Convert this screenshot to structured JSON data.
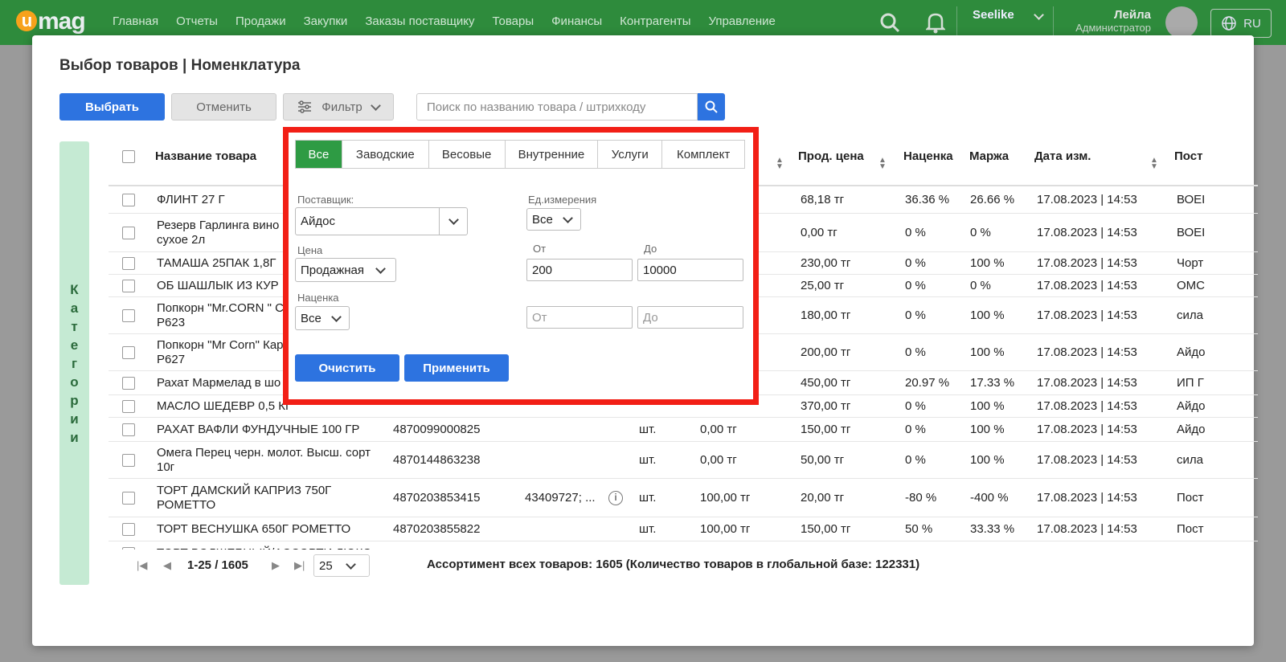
{
  "topbar": {
    "logo": "mag",
    "logo_u": "u",
    "nav": [
      "Главная",
      "Отчеты",
      "Продажи",
      "Закупки",
      "Заказы поставщику",
      "Товары",
      "Финансы",
      "Контрагенты",
      "Управление"
    ],
    "store": "Seelike",
    "user_name": "Лейла",
    "user_role": "Администратор",
    "lang": "RU",
    "icons": [
      "search-icon",
      "bell-icon",
      "avatar",
      "globe-icon"
    ],
    "accent": "#2e8b3c"
  },
  "modal": {
    "title": "Выбор товаров | Номенклатура",
    "select_btn": "Выбрать",
    "cancel_btn": "Отменить",
    "filter_btn": "Фильтр",
    "search_placeholder": "Поиск по названию товара / штрихкоду",
    "categories_label": [
      "К",
      "а",
      "т",
      "е",
      "г",
      "о",
      "р",
      "и",
      "и"
    ]
  },
  "table": {
    "headers": {
      "name": "Название товара",
      "prod_price": "Прод. цена",
      "markup": "Наценка",
      "margin": "Маржа",
      "date": "Дата изм.",
      "supplier": "Пост"
    },
    "rows": [
      {
        "name": "ФЛИНТ 27 Г",
        "barcode": "",
        "code": "",
        "unit": "",
        "buy": "",
        "sell": "68,18 тг",
        "markup": "36.36 %",
        "margin": "26.66 %",
        "date": "17.08.2023 | 14:53",
        "supplier": "ВОЕІ"
      },
      {
        "name": "Резерв Гарлинга вино",
        "name2": "сухое 2л",
        "barcode": "",
        "code": "",
        "unit": "",
        "buy": "",
        "sell": "0,00 тг",
        "markup": "0 %",
        "margin": "0 %",
        "date": "17.08.2023 | 14:53",
        "supplier": "ВОЕІ"
      },
      {
        "name": "ТАМАША 25ПАК 1,8Г",
        "barcode": "",
        "code": "",
        "unit": "",
        "buy": "",
        "sell": "230,00 тг",
        "markup": "0 %",
        "margin": "100 %",
        "date": "17.08.2023 | 14:53",
        "supplier": "Чорт"
      },
      {
        "name": "ОБ ШАШЛЫК ИЗ КУР",
        "barcode": "",
        "code": "",
        "unit": "",
        "buy": "",
        "sell": "25,00 тг",
        "markup": "0 %",
        "margin": "0 %",
        "date": "17.08.2023 | 14:53",
        "supplier": "ОМС"
      },
      {
        "name": "Попкорн \"Mr.CORN \" С",
        "name2": "Р623",
        "barcode": "",
        "code": "",
        "unit": "",
        "buy": "",
        "sell": "180,00 тг",
        "markup": "0 %",
        "margin": "100 %",
        "date": "17.08.2023 | 14:53",
        "supplier": "сила"
      },
      {
        "name": "Попкорн \"Mr Corn\" Кар",
        "name2": "Р627",
        "barcode": "",
        "code": "",
        "unit": "",
        "buy": "",
        "sell": "200,00 тг",
        "markup": "0 %",
        "margin": "100 %",
        "date": "17.08.2023 | 14:53",
        "supplier": "Айдо"
      },
      {
        "name": "Рахат Мармелад в шо",
        "barcode": "",
        "code": "",
        "unit": "",
        "buy": "",
        "sell": "450,00 тг",
        "markup": "20.97 %",
        "margin": "17.33 %",
        "date": "17.08.2023 | 14:53",
        "supplier": "ИП Г"
      },
      {
        "name": "МАСЛО ШЕДЕВР 0,5 КГ",
        "barcode": "",
        "code": "",
        "unit": "",
        "buy": "",
        "sell": "370,00 тг",
        "markup": "0 %",
        "margin": "100 %",
        "date": "17.08.2023 | 14:53",
        "supplier": "Айдо"
      },
      {
        "name": "РАХАТ ВАФЛИ ФУНДУЧНЫЕ 100 ГР",
        "barcode": "4870099000825",
        "code": "",
        "unit": "шт.",
        "buy": "0,00 тг",
        "sell": "150,00 тг",
        "markup": "0 %",
        "margin": "100 %",
        "date": "17.08.2023 | 14:53",
        "supplier": "Айдо"
      },
      {
        "name": "Омега Перец черн. молот. Высш. сорт",
        "name2": "10г",
        "barcode": "4870144863238",
        "code": "",
        "unit": "шт.",
        "buy": "0,00 тг",
        "sell": "50,00 тг",
        "markup": "0 %",
        "margin": "100 %",
        "date": "17.08.2023 | 14:53",
        "supplier": "сила"
      },
      {
        "name": "ТОРТ ДАМСКИЙ КАПРИЗ 750Г",
        "name2": "РОМЕТТО",
        "barcode": "4870203853415",
        "code": "43409727; ...",
        "unit": "шт.",
        "buy": "100,00 тг",
        "sell": "20,00 тг",
        "markup": "-80 %",
        "margin": "-400 %",
        "date": "17.08.2023 | 14:53",
        "supplier": "Пост"
      },
      {
        "name": "ТОРТ ВЕСНУШКА 650Г РОМЕТТО",
        "barcode": "4870203855822",
        "code": "",
        "unit": "шт.",
        "buy": "100,00 тг",
        "sell": "150,00 тг",
        "markup": "50 %",
        "margin": "33.33 %",
        "date": "17.08.2023 | 14:53",
        "supplier": "Пост"
      },
      {
        "name": "ТОРТ ВОЛШЕБНЫЙ/АССОРТИ ЛЮКС",
        "barcode": "",
        "code": "",
        "unit": "",
        "buy": "",
        "sell": "",
        "markup": "",
        "margin": "",
        "date": "",
        "supplier": ""
      }
    ]
  },
  "pager": {
    "range": "1-25 / 1605",
    "page_size": "25",
    "summary": "Ассортимент всех товаров: 1605 (Количество товаров в глобальной базе: 122331)"
  },
  "filter": {
    "tabs": [
      "Все",
      "Заводские",
      "Весовые",
      "Внутренние",
      "Услуги",
      "Комплект"
    ],
    "active_tab": "Все",
    "supplier_label": "Поставщик:",
    "supplier_value": "Айдос",
    "unit_label": "Ед.измерения",
    "unit_value": "Все",
    "price_label": "Цена",
    "price_type": "Продажная",
    "from_label": "От",
    "to_label": "До",
    "price_from": "200",
    "price_to": "10000",
    "markup_label": "Наценка",
    "markup_type": "Все",
    "markup_from_placeholder": "От",
    "markup_to_placeholder": "До",
    "clear_btn": "Очистить",
    "apply_btn": "Применить",
    "highlight_color": "#f21f16"
  }
}
